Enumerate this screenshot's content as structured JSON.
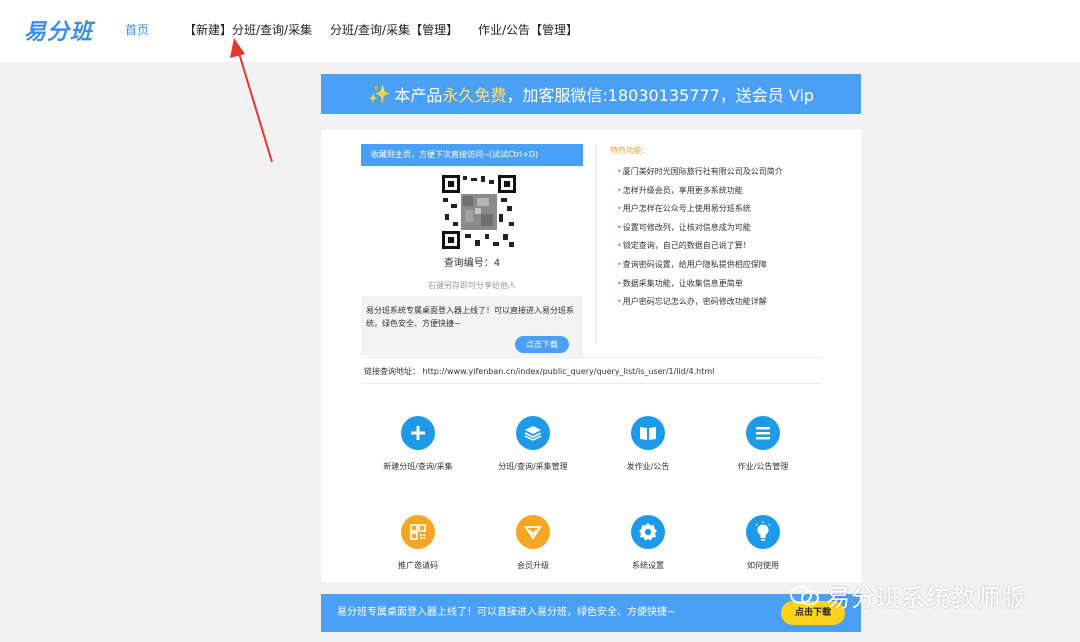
{
  "colors": {
    "accent": "#4aa0f5",
    "logo": "#3d8ee8",
    "arrow": "#e8352b",
    "highlight": "#ffe36e",
    "feature_title": "#f0a030"
  },
  "nav": {
    "logo": "易分班",
    "items": [
      {
        "label": "首页",
        "active": true
      },
      {
        "label": "【新建】分班/查询/采集",
        "active": false
      },
      {
        "label": "分班/查询/采集【管理】",
        "active": false
      },
      {
        "label": "作业/公告【管理】",
        "active": false
      }
    ]
  },
  "promo": {
    "prefix": "本产品",
    "highlight": "永久免费",
    "suffix": "，加客服微信:18030135777，送会员 Vip"
  },
  "fav_bar": "收藏到主页，方便下次直接访问--(试试Ctrl+D)",
  "qr": {
    "label": "查询编号：4",
    "save_hint": "右键另存即可分享给他人"
  },
  "download_box": {
    "text": "易分班系统专属桌面登入器上线了！可以直接进入易分班系统，绿色安全、方便快捷~",
    "button": "点击下载"
  },
  "features": {
    "title": "特色功能：",
    "items": [
      "厦门美好时光国际旅行社有限公司及公司简介",
      "怎样升级会员，享用更多系统功能",
      "用户怎样在公众号上使用易分班系统",
      "设置可修改列，让核对信息成为可能",
      "锁定查询，自己的数据自己说了算！",
      "查询密码设置，给用户隐私提供相应保障",
      "数据采集功能，让收集信息更简单",
      "用户密码忘记怎么办，密码修改功能详解"
    ]
  },
  "link": {
    "label": "链接查询地址：",
    "url": "http://www.yifenban.cn/index/public_query/query_list/is_user/1/lid/4.html"
  },
  "shortcuts": [
    {
      "label": "新建分班/查询/采集",
      "icon": "plus-icon",
      "color": "#1e9be8"
    },
    {
      "label": "分班/查询/采集管理",
      "icon": "layers-icon",
      "color": "#1e9be8"
    },
    {
      "label": "发作业/公告",
      "icon": "book-icon",
      "color": "#1e9be8"
    },
    {
      "label": "作业/公告管理",
      "icon": "list-icon",
      "color": "#1e9be8"
    },
    {
      "label": "推广邀请码",
      "icon": "qr-code-icon",
      "color": "#f5a623"
    },
    {
      "label": "会员升级",
      "icon": "diamond-icon",
      "color": "#f5a623"
    },
    {
      "label": "系统设置",
      "icon": "gear-icon",
      "color": "#1e9be8"
    },
    {
      "label": "如何使用",
      "icon": "lightbulb-icon",
      "color": "#1e9be8"
    }
  ],
  "bottom_banner": {
    "text": "易分班专属桌面登入器上线了！可以直接进入易分班，绿色安全、方便快捷~",
    "button": "点击下载"
  },
  "watermark": "易分班系统教师版"
}
